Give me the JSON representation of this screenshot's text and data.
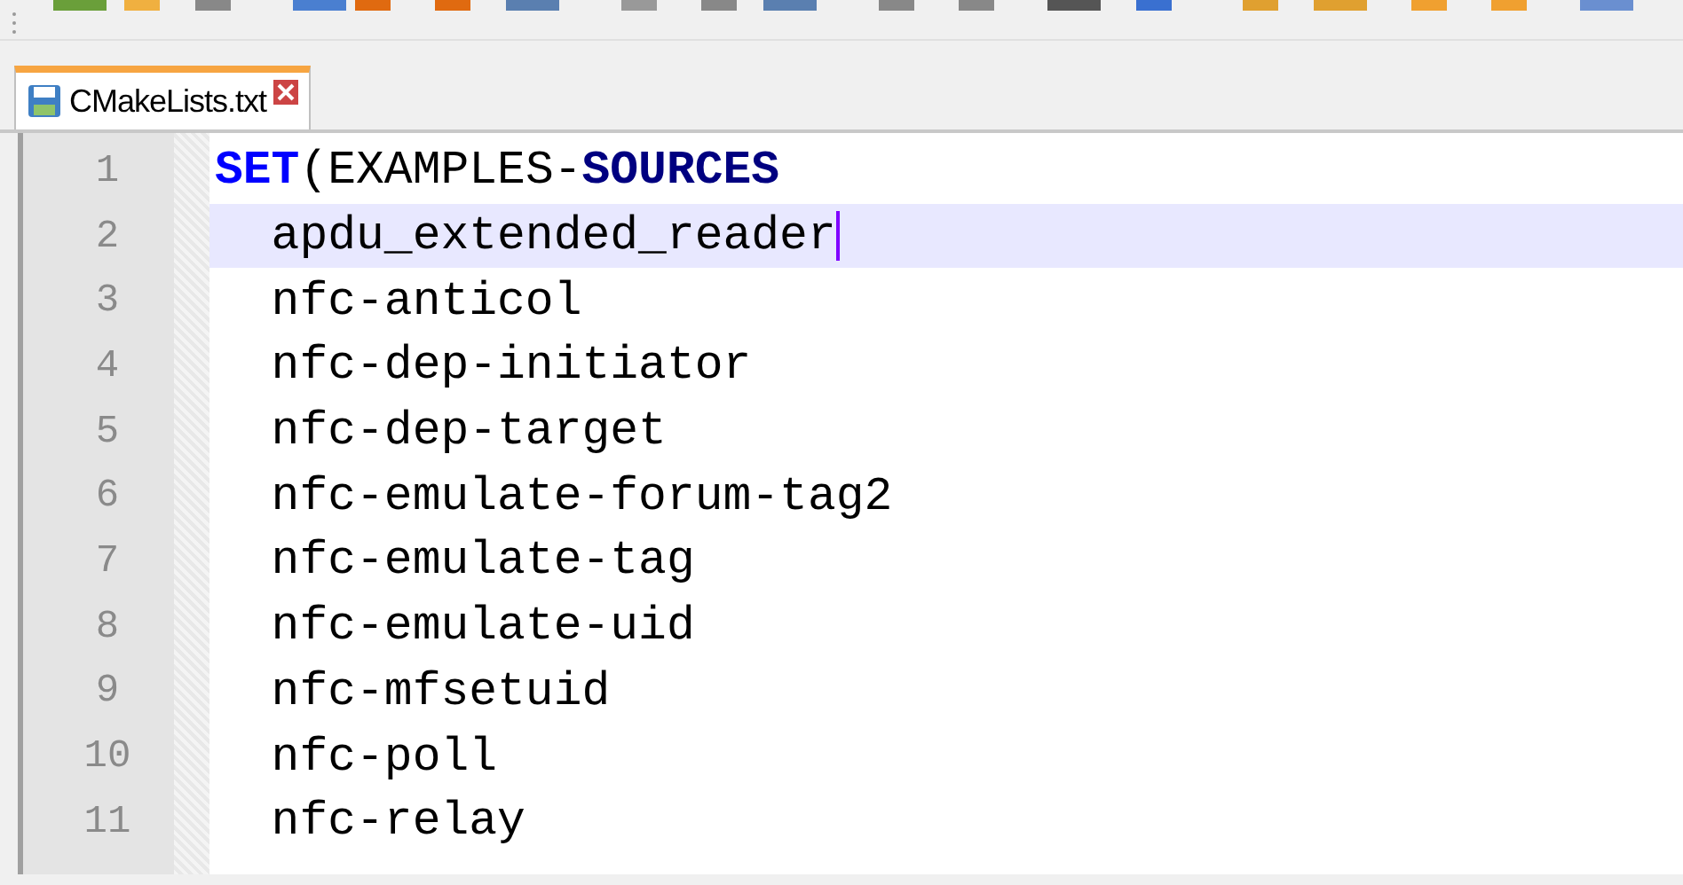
{
  "tabs": [
    {
      "label": "CMakeLists.txt",
      "selected": true
    }
  ],
  "lines": [
    {
      "number": "1",
      "current": false,
      "tokens": [
        {
          "text": "SET",
          "kind": "keyword"
        },
        {
          "text": "(EXAMPLES-",
          "kind": "plain"
        },
        {
          "text": "SOURCES",
          "kind": "variable"
        }
      ]
    },
    {
      "number": "2",
      "current": true,
      "tokens": [
        {
          "text": "  apdu_extended_reader",
          "kind": "plain"
        }
      ]
    },
    {
      "number": "3",
      "current": false,
      "tokens": [
        {
          "text": "  nfc-anticol",
          "kind": "plain"
        }
      ]
    },
    {
      "number": "4",
      "current": false,
      "tokens": [
        {
          "text": "  nfc-dep-initiator",
          "kind": "plain"
        }
      ]
    },
    {
      "number": "5",
      "current": false,
      "tokens": [
        {
          "text": "  nfc-dep-target",
          "kind": "plain"
        }
      ]
    },
    {
      "number": "6",
      "current": false,
      "tokens": [
        {
          "text": "  nfc-emulate-forum-tag2",
          "kind": "plain"
        }
      ]
    },
    {
      "number": "7",
      "current": false,
      "tokens": [
        {
          "text": "  nfc-emulate-tag",
          "kind": "plain"
        }
      ]
    },
    {
      "number": "8",
      "current": false,
      "tokens": [
        {
          "text": "  nfc-emulate-uid",
          "kind": "plain"
        }
      ]
    },
    {
      "number": "9",
      "current": false,
      "tokens": [
        {
          "text": "  nfc-mfsetuid",
          "kind": "plain"
        }
      ]
    },
    {
      "number": "10",
      "current": false,
      "tokens": [
        {
          "text": "  nfc-poll",
          "kind": "plain"
        }
      ]
    },
    {
      "number": "11",
      "current": false,
      "tokens": [
        {
          "text": "  nfc-relay",
          "kind": "plain"
        }
      ]
    }
  ]
}
